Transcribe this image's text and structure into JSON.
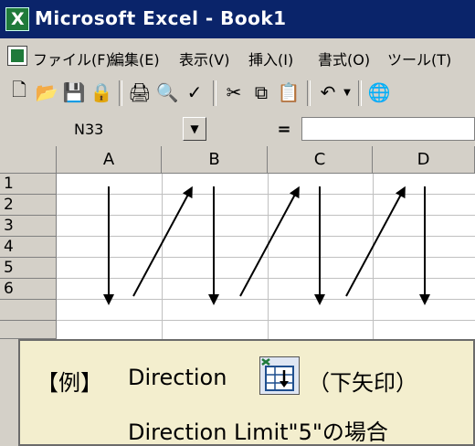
{
  "window": {
    "title": "Microsoft Excel - Book1"
  },
  "menu": {
    "items": [
      "ファイル(F)",
      "編集(E)",
      "表示(V)",
      "挿入(I)",
      "書式(O)",
      "ツール(T)"
    ]
  },
  "toolbar": {
    "buttons": [
      {
        "name": "new-icon",
        "glyph": "🗋"
      },
      {
        "name": "open-icon",
        "glyph": "📂"
      },
      {
        "name": "save-icon",
        "glyph": "💾"
      },
      {
        "name": "permission-icon",
        "glyph": "🔒"
      },
      {
        "name": "print-icon",
        "glyph": "🖨"
      },
      {
        "name": "print-preview-icon",
        "glyph": "🔍"
      },
      {
        "name": "spelling-icon",
        "glyph": "✓"
      },
      {
        "name": "cut-icon",
        "glyph": "✂"
      },
      {
        "name": "copy-icon",
        "glyph": "⧉"
      },
      {
        "name": "paste-icon",
        "glyph": "📋"
      },
      {
        "name": "undo-icon",
        "glyph": "↶"
      },
      {
        "name": "web-icon",
        "glyph": "🌐"
      }
    ]
  },
  "formula_bar": {
    "name_box": "N33",
    "equals": "="
  },
  "sheet": {
    "columns": [
      "A",
      "B",
      "C",
      "D"
    ],
    "rows": [
      "1",
      "2",
      "3",
      "4",
      "5",
      "6"
    ]
  },
  "callout": {
    "example_label": "【例】",
    "direction_label": "Direction",
    "paren_note": "（下矢印）",
    "limit_note": "Direction Limit\"5\"の場合"
  }
}
